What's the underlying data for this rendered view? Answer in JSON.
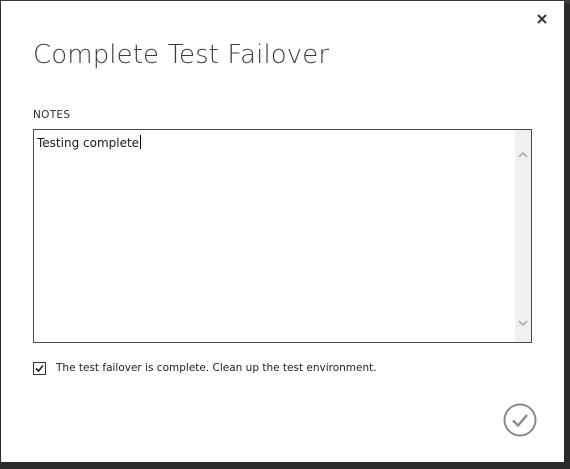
{
  "dialog": {
    "title": "Complete Test Failover",
    "close_icon": "close-icon",
    "notes": {
      "label": "NOTES",
      "value": "Testing complete"
    },
    "cleanup_checkbox": {
      "checked": true,
      "label": "The test failover is complete. Clean up the test environment."
    },
    "ok_icon": "checkmark-circle-icon"
  },
  "colors": {
    "background": "#2b2b2b",
    "dialog": "#ffffff",
    "title": "#3c3c3c",
    "border": "#4a4a4a",
    "icon": "#7a7a7a"
  }
}
